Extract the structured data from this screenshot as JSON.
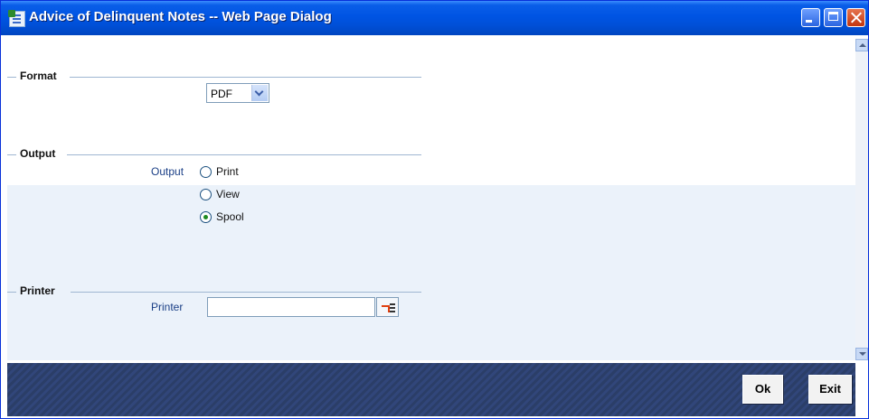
{
  "window": {
    "title": "Advice of Delinquent Notes -- Web Page Dialog"
  },
  "format": {
    "legend": "Format",
    "selected": "PDF"
  },
  "output": {
    "legend": "Output",
    "label": "Output",
    "options": [
      "Print",
      "View",
      "Spool"
    ],
    "selected": "Spool"
  },
  "printer": {
    "legend": "Printer",
    "label": "Printer",
    "value": ""
  },
  "footer": {
    "ok_label": "Ok",
    "exit_label": "Exit"
  },
  "colors": {
    "titlebar": "#0054e3",
    "band": "#ebf2fa",
    "label_blue": "#1a3f86",
    "footer": "#2b3e68"
  }
}
